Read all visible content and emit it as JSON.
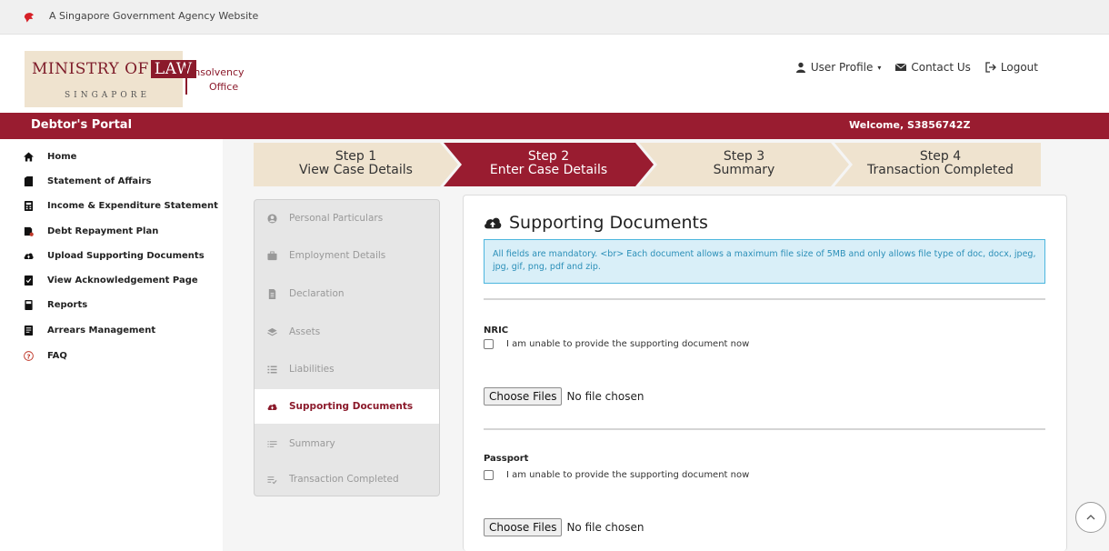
{
  "top_banner": {
    "text": "A Singapore Government Agency Website",
    "icon": "lion-head-icon"
  },
  "logo": {
    "ministry_part1": "Ministry of",
    "ministry_part2": "Law",
    "country": "SINGAPORE",
    "office_line1": "Insolvency",
    "office_line2": "Office"
  },
  "header_nav": {
    "user_profile": "User Profile",
    "contact_us": "Contact Us",
    "logout": "Logout"
  },
  "portal_bar": {
    "title": "Debtor's Portal",
    "welcome": "Welcome, S3856742Z"
  },
  "sidebar": {
    "items": [
      {
        "label": "Home",
        "icon": "home-icon"
      },
      {
        "label": "Statement of Affairs",
        "icon": "document-icon"
      },
      {
        "label": "Income & Expenditure Statement",
        "icon": "calculator-icon"
      },
      {
        "label": "Debt Repayment Plan",
        "icon": "repayment-icon"
      },
      {
        "label": "Upload Supporting Documents",
        "icon": "cloud-upload-icon"
      },
      {
        "label": "View Acknowledgement Page",
        "icon": "acknowledgement-icon"
      },
      {
        "label": "Reports",
        "icon": "book-icon"
      },
      {
        "label": "Arrears Management",
        "icon": "ledger-icon"
      },
      {
        "label": "FAQ",
        "icon": "question-icon"
      }
    ]
  },
  "steps": [
    {
      "title": "Step 1",
      "subtitle": "View Case Details",
      "state": "done"
    },
    {
      "title": "Step 2",
      "subtitle": "Enter Case Details",
      "state": "active"
    },
    {
      "title": "Step 3",
      "subtitle": "Summary",
      "state": "todo"
    },
    {
      "title": "Step 4",
      "subtitle": "Transaction Completed",
      "state": "todo"
    }
  ],
  "left_menu": {
    "items": [
      {
        "label": "Personal Particulars",
        "icon": "user-circle-icon"
      },
      {
        "label": "Employment Details",
        "icon": "briefcase-icon"
      },
      {
        "label": "Declaration",
        "icon": "file-text-icon"
      },
      {
        "label": "Assets",
        "icon": "layers-icon"
      },
      {
        "label": "Liabilities",
        "icon": "list-icon"
      },
      {
        "label": "Supporting Documents",
        "icon": "cloud-upload-icon",
        "active": true
      },
      {
        "label": "Summary",
        "icon": "summary-list-icon"
      },
      {
        "label": "Transaction Completed",
        "icon": "checklist-icon"
      }
    ]
  },
  "content": {
    "title": "Supporting Documents",
    "alert": "All fields are mandatory. <br> Each document allows a maximum file size of 5MB and only allows file type of doc, docx, jpeg, jpg, gif, png, pdf and zip.",
    "documents": [
      {
        "label": "NRIC",
        "checkbox_label": "I am unable to provide the supporting document now",
        "button": "Choose Files",
        "file_status": "No file chosen"
      },
      {
        "label": "Passport",
        "checkbox_label": "I am unable to provide the supporting document now",
        "button": "Choose Files",
        "file_status": "No file chosen"
      }
    ]
  },
  "colors": {
    "brand_red": "#991c30",
    "step_beige": "#efe3cf",
    "alert_bg": "#d9eff8",
    "alert_border": "#4cb6de"
  }
}
